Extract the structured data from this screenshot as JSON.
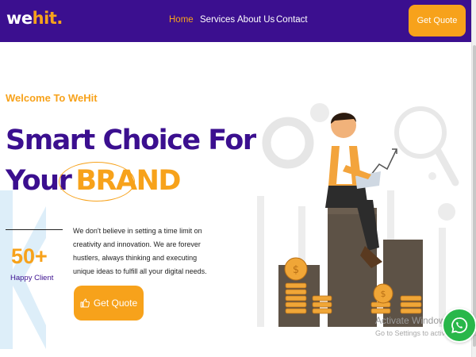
{
  "brand": {
    "logo_main": "we",
    "logo_accent": "hit."
  },
  "nav": {
    "items": [
      {
        "label": "Home",
        "active": true
      },
      {
        "label": "Services"
      },
      {
        "label": "About Us"
      },
      {
        "label": "Contact"
      }
    ],
    "quote_label": "Get Quote"
  },
  "hero": {
    "welcome": "Welcome To WeHit",
    "headline_line1": "Smart Choice For",
    "headline_line2_prefix": "Your",
    "headline_line2_highlight": "BRAND",
    "stat_number": "50+",
    "stat_label": "Happy Client",
    "description": "We don't believe in setting a time limit on creativity and innovation. We are forever hustlers, always thinking and executing unique ideas to fulfill all your digital needs.",
    "cta_label": "Get Quote"
  },
  "os_overlay": {
    "title": "Activate Windows",
    "subtitle": "Go to Settings to activate Windows."
  },
  "icons": {
    "cta": "thumbs-up-icon",
    "floating": "whatsapp-icon"
  },
  "colors": {
    "primary": "#3b0f8f",
    "accent": "#f7a21b",
    "whatsapp": "#29b74a"
  }
}
